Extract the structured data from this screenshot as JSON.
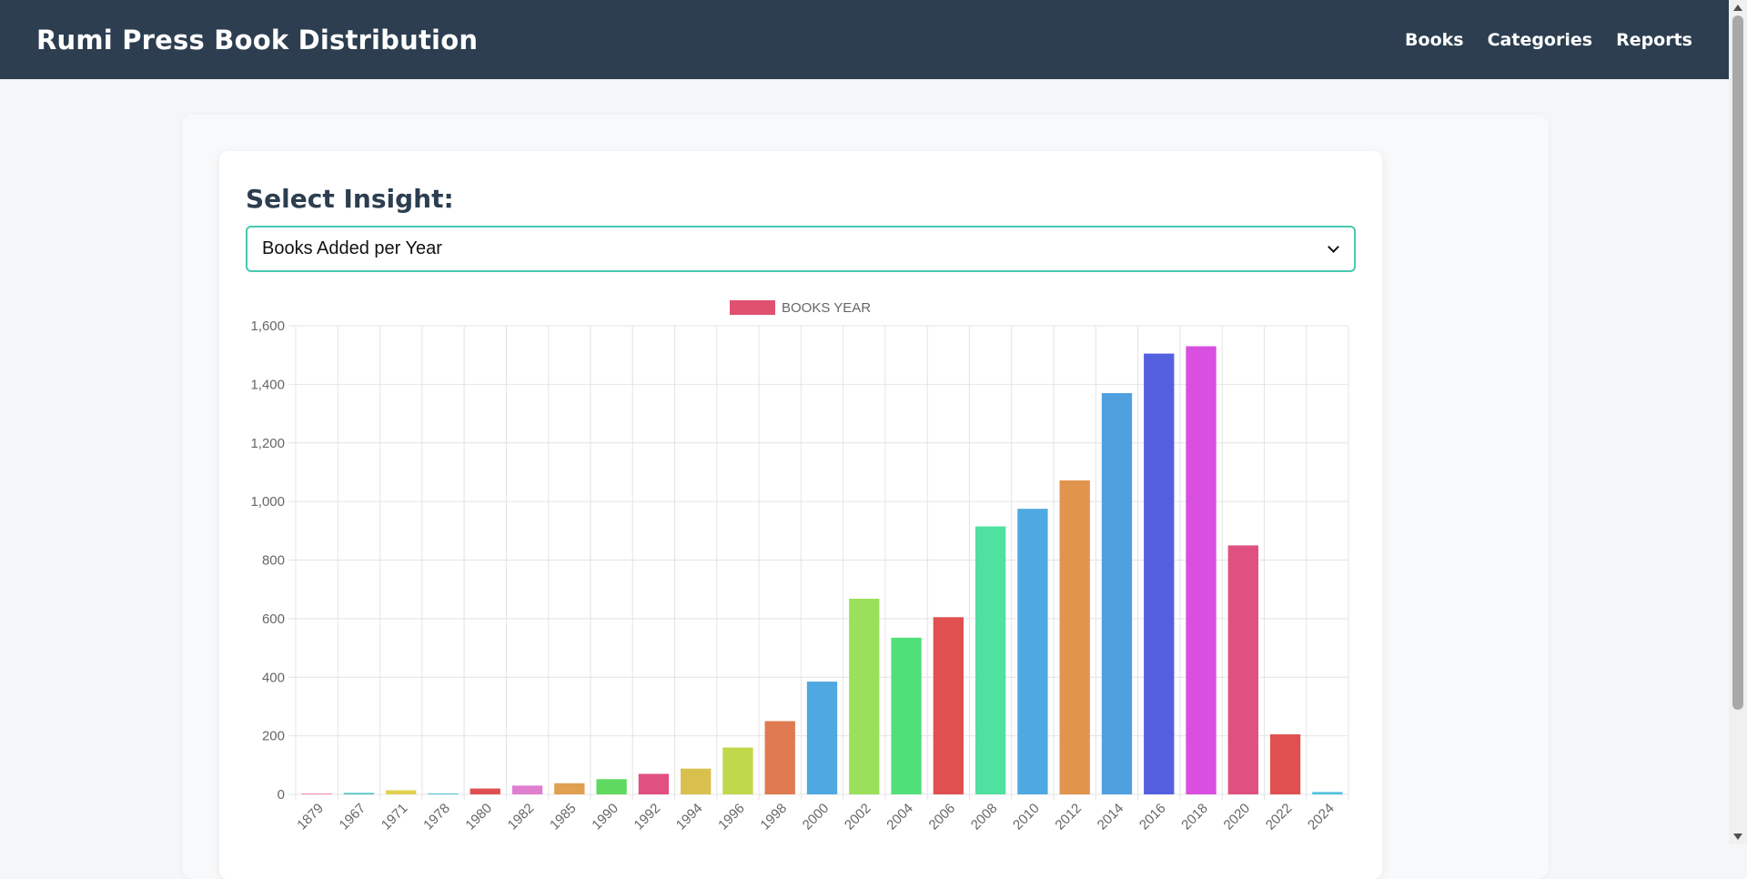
{
  "header": {
    "title": "Rumi Press Book Distribution",
    "nav": [
      "Books",
      "Categories",
      "Reports"
    ]
  },
  "insight": {
    "label": "Select Insight:",
    "selected": "Books Added per Year"
  },
  "chart_data": {
    "type": "bar",
    "legend": "BOOKS YEAR",
    "legend_position": "top",
    "grid": true,
    "ylim": [
      0,
      1600
    ],
    "yticks": [
      0,
      200,
      400,
      600,
      800,
      1000,
      1200,
      1400,
      1600
    ],
    "categories": [
      "1879",
      "1967",
      "1971",
      "1978",
      "1980",
      "1982",
      "1985",
      "1990",
      "1992",
      "1994",
      "1996",
      "1998",
      "2000",
      "2002",
      "2004",
      "2006",
      "2008",
      "2010",
      "2012",
      "2014",
      "2016",
      "2018",
      "2020",
      "2022",
      "2024"
    ],
    "values": [
      2,
      5,
      14,
      3,
      20,
      30,
      38,
      52,
      70,
      88,
      160,
      250,
      385,
      668,
      535,
      605,
      915,
      975,
      1072,
      1370,
      1505,
      1530,
      850,
      205,
      8
    ],
    "colors": [
      "#e05170",
      "#4bc0c0",
      "#e0d050",
      "#4fc3e0",
      "#e05050",
      "#e07ed0",
      "#e0a050",
      "#5fd95f",
      "#e05080",
      "#d9c04c",
      "#c0d94c",
      "#e07a50",
      "#50a8e0",
      "#9be05a",
      "#50e07a",
      "#e05050",
      "#50e0a0",
      "#50a8e0",
      "#e0944c",
      "#50a0e0",
      "#5560e0",
      "#d950e0",
      "#e05080",
      "#e05050",
      "#50c0e0"
    ]
  }
}
